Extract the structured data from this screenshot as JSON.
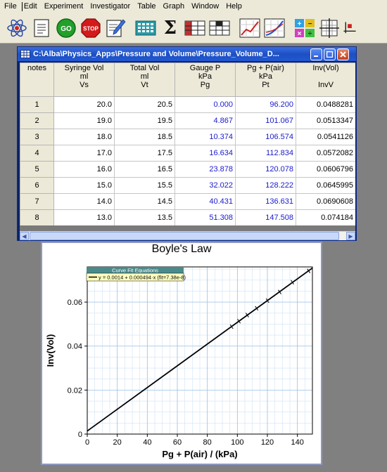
{
  "menu": [
    "File",
    "Edit",
    "Experiment",
    "Investigator",
    "Table",
    "Graph",
    "Window",
    "Help"
  ],
  "toolbar": {
    "go_label": "GO",
    "stop_label": "STOP",
    "sigma": "Σ"
  },
  "data_window": {
    "title": "C:\\Alba\\Physics_Apps\\Pressure and Volume\\Pressure_Volume_D...",
    "columns": [
      {
        "name": "notes",
        "unit": "",
        "symbol": ""
      },
      {
        "name": "Syringe Vol",
        "unit": "ml",
        "symbol": "Vs"
      },
      {
        "name": "Total Vol",
        "unit": "ml",
        "symbol": "Vt"
      },
      {
        "name": "Gauge P",
        "unit": "kPa",
        "symbol": "Pg"
      },
      {
        "name": "Pg + P(air)",
        "unit": "kPa",
        "symbol": "Pt"
      },
      {
        "name": "Inv(Vol)",
        "unit": "",
        "symbol": "InvV"
      }
    ],
    "rows": [
      {
        "n": "1",
        "vs": "20.0",
        "vt": "20.5",
        "pg": "0.000",
        "pt": "96.200",
        "inv": "0.0488281"
      },
      {
        "n": "2",
        "vs": "19.0",
        "vt": "19.5",
        "pg": "4.867",
        "pt": "101.067",
        "inv": "0.0513347"
      },
      {
        "n": "3",
        "vs": "18.0",
        "vt": "18.5",
        "pg": "10.374",
        "pt": "106.574",
        "inv": "0.0541126"
      },
      {
        "n": "4",
        "vs": "17.0",
        "vt": "17.5",
        "pg": "16.634",
        "pt": "112.834",
        "inv": "0.0572082"
      },
      {
        "n": "5",
        "vs": "16.0",
        "vt": "16.5",
        "pg": "23.878",
        "pt": "120.078",
        "inv": "0.0606796"
      },
      {
        "n": "6",
        "vs": "15.0",
        "vt": "15.5",
        "pg": "32.022",
        "pt": "128.222",
        "inv": "0.0645995"
      },
      {
        "n": "7",
        "vs": "14.0",
        "vt": "14.5",
        "pg": "40.431",
        "pt": "136.631",
        "inv": "0.0690608"
      },
      {
        "n": "8",
        "vs": "13.0",
        "vt": "13.5",
        "pg": "51.308",
        "pt": "147.508",
        "inv": "0.074184"
      }
    ],
    "colors": {
      "calc_text": "#1a1acd",
      "title_bar": "#2158d1"
    }
  },
  "chart_data": {
    "type": "scatter",
    "title": "Boyle's Law",
    "xlabel": "Pg + P(air) / (kPa)",
    "ylabel": "Inv(Vol)",
    "xlim": [
      0,
      150
    ],
    "ylim": [
      0,
      0.076
    ],
    "xticks": [
      0,
      20,
      40,
      60,
      80,
      100,
      120,
      140
    ],
    "yticks": [
      0,
      0.02,
      0.04,
      0.06
    ],
    "ytick_labels": [
      "0",
      "0.02",
      "0.04",
      "0.06"
    ],
    "grid": true,
    "points": [
      {
        "x": 96.2,
        "y": 0.0488281
      },
      {
        "x": 101.067,
        "y": 0.0513347
      },
      {
        "x": 106.574,
        "y": 0.0541126
      },
      {
        "x": 112.834,
        "y": 0.0572082
      },
      {
        "x": 120.078,
        "y": 0.0606796
      },
      {
        "x": 128.222,
        "y": 0.0645995
      },
      {
        "x": 136.631,
        "y": 0.0690608
      },
      {
        "x": 147.508,
        "y": 0.074184
      }
    ],
    "fit": {
      "intercept": 0.0014,
      "slope": 0.000494
    },
    "legend_title": "Curve Fit Equations",
    "legend_entry": "y = 0.0014 + 0.000494·x (fit=7.38e-8)",
    "legend_position": "top-left"
  }
}
